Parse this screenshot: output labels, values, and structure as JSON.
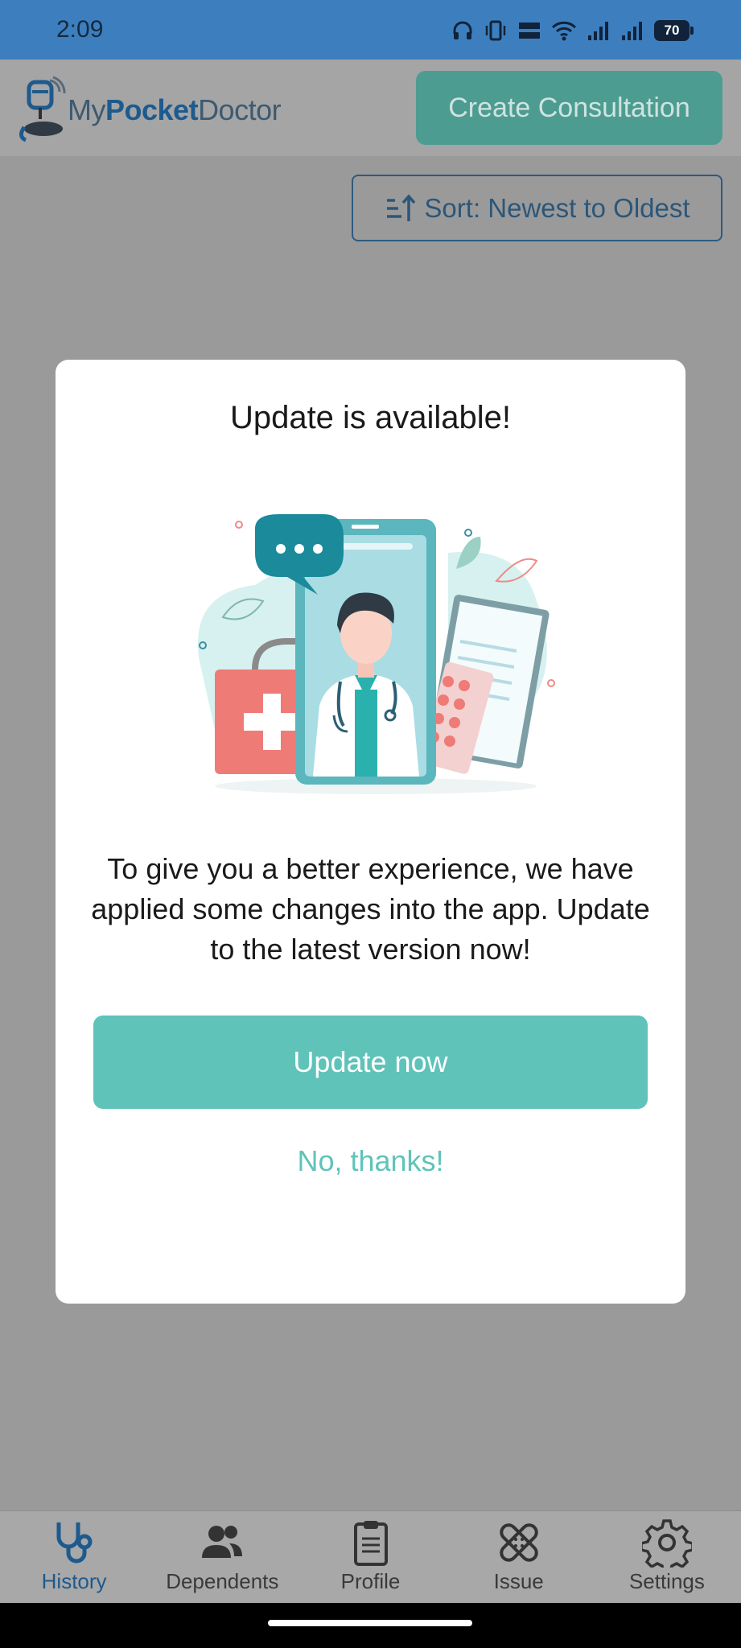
{
  "status_bar": {
    "time": "2:09",
    "battery": "70"
  },
  "header": {
    "logo": {
      "my": "My",
      "pocket": "Pocket",
      "doctor": "Doctor"
    },
    "create_button": "Create Consultation"
  },
  "toolbar": {
    "sort_label": "Sort: Newest to Oldest"
  },
  "dialog": {
    "title": "Update is available!",
    "message": "To give you a better experience, we have applied some changes into the app. Update to the latest version now!",
    "update_button": "Update now",
    "dismiss_link": "No, thanks!"
  },
  "bottom_nav": {
    "items": [
      {
        "label": "History",
        "icon": "stethoscope-icon",
        "active": true
      },
      {
        "label": "Dependents",
        "icon": "people-icon",
        "active": false
      },
      {
        "label": "Profile",
        "icon": "clipboard-icon",
        "active": false
      },
      {
        "label": "Issue",
        "icon": "bandage-icon",
        "active": false
      },
      {
        "label": "Settings",
        "icon": "gear-icon",
        "active": false
      }
    ]
  },
  "colors": {
    "status_bar": "#3d7fbe",
    "brand_blue": "#1d5a8e",
    "teal_primary": "#5fc3ba",
    "overlay_gray": "#9a9a9a"
  }
}
